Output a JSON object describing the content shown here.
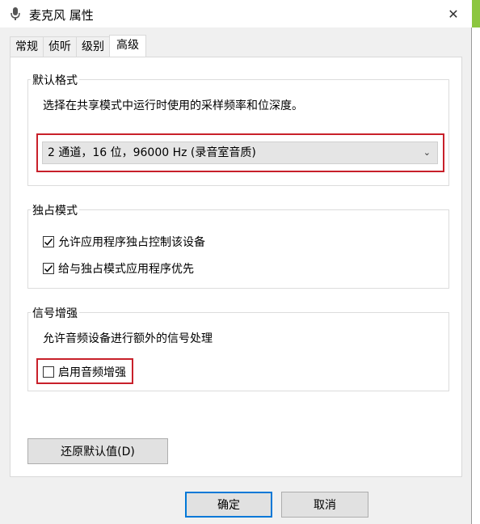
{
  "window": {
    "title": "麦克风 属性",
    "close_glyph": "✕"
  },
  "tabs": [
    {
      "label": "常规"
    },
    {
      "label": "侦听"
    },
    {
      "label": "级别"
    },
    {
      "label": "高级"
    }
  ],
  "active_tab": "高级",
  "default_format": {
    "title": "默认格式",
    "description": "选择在共享模式中运行时使用的采样频率和位深度。",
    "selected_value": "2 通道，16 位，96000 Hz (录音室音质)"
  },
  "exclusive_mode": {
    "title": "独占模式",
    "options": [
      {
        "label": "允许应用程序独占控制该设备",
        "checked": true
      },
      {
        "label": "给与独占模式应用程序优先",
        "checked": true
      }
    ]
  },
  "signal_enhancement": {
    "title": "信号增强",
    "description": "允许音频设备进行额外的信号处理",
    "option": {
      "label": "启用音频增强",
      "checked": false
    }
  },
  "buttons": {
    "restore_defaults": "还原默认值(D)",
    "ok": "确定",
    "cancel": "取消"
  },
  "colors": {
    "accent_red": "#c8202a",
    "primary_blue": "#0078d7",
    "titlebar_green_behind": "#8cc63f"
  }
}
